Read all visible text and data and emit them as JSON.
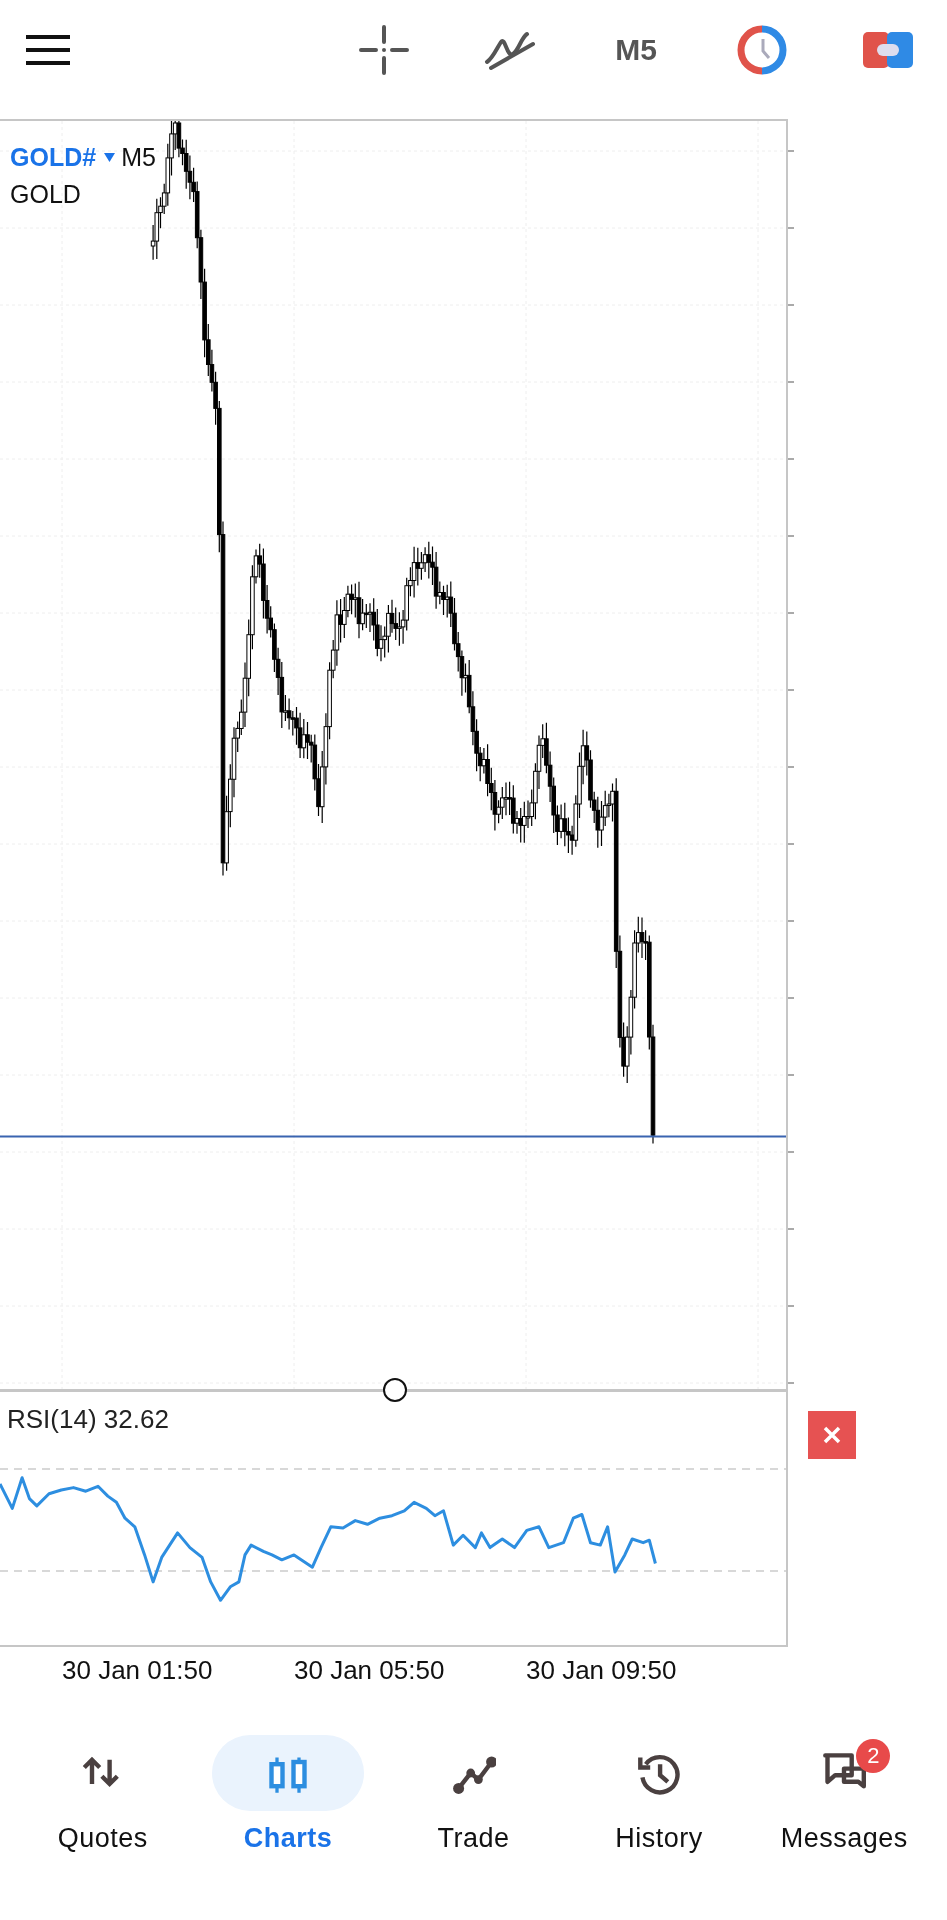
{
  "header": {
    "timeframe": "M5"
  },
  "chart": {
    "symbol": "GOLD#",
    "timeframe": "M5",
    "description": "GOLD",
    "indicator": "RSI(14) 32.62",
    "time_labels": [
      "30 Jan 01:50",
      "30 Jan 05:50",
      "30 Jan 09:50"
    ]
  },
  "nav": [
    {
      "kind": "quotes",
      "label": "Quotes",
      "selected": false
    },
    {
      "kind": "charts",
      "label": "Charts",
      "selected": true
    },
    {
      "kind": "trade",
      "label": "Trade",
      "selected": false
    },
    {
      "kind": "history",
      "label": "History",
      "selected": false
    },
    {
      "kind": "messages",
      "label": "Messages",
      "selected": false,
      "badge": "2"
    }
  ]
}
